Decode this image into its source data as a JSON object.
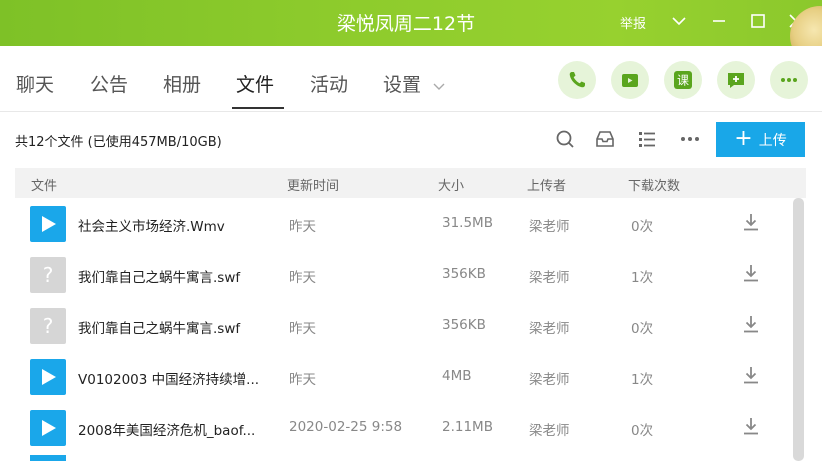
{
  "window": {
    "title": "梁悦凤周二12节",
    "report_label": "举报"
  },
  "tabs": [
    {
      "label": "聊天"
    },
    {
      "label": "公告"
    },
    {
      "label": "相册"
    },
    {
      "label": "文件",
      "active": true
    },
    {
      "label": "活动"
    },
    {
      "label": "设置"
    }
  ],
  "actions": [
    {
      "icon": "phone-icon"
    },
    {
      "icon": "video-call-icon"
    },
    {
      "icon": "lesson-icon",
      "text": "课"
    },
    {
      "icon": "add-message-icon"
    },
    {
      "icon": "more-icon"
    }
  ],
  "toolbar": {
    "summary": "共12个文件 (已使用457MB/10GB)",
    "upload_label": "上传"
  },
  "columns": {
    "file": "文件",
    "updated": "更新时间",
    "size": "大小",
    "uploader": "上传者",
    "downloads": "下载次数"
  },
  "files": [
    {
      "type": "video",
      "name": "社会主义市场经济.Wmv",
      "updated": "昨天",
      "size": "31.5MB",
      "uploader": "梁老师",
      "downloads": "0次"
    },
    {
      "type": "unknown",
      "name": "我们靠自己之蜗牛寓言.swf",
      "updated": "昨天",
      "size": "356KB",
      "uploader": "梁老师",
      "downloads": "1次"
    },
    {
      "type": "unknown",
      "name": "我们靠自己之蜗牛寓言.swf",
      "updated": "昨天",
      "size": "356KB",
      "uploader": "梁老师",
      "downloads": "0次"
    },
    {
      "type": "video",
      "name": "V0102003 中国经济持续增...",
      "updated": "昨天",
      "size": "4MB",
      "uploader": "梁老师",
      "downloads": "1次"
    },
    {
      "type": "video",
      "name": "2008年美国经济危机_baof...",
      "updated": "2020-02-25 9:58",
      "size": "2.11MB",
      "uploader": "梁老师",
      "downloads": "0次"
    }
  ],
  "colors": {
    "title_bar": "#8dcb2c",
    "accent_blue": "#19a7e8",
    "action_bg": "#e6f4d9",
    "action_fg": "#5aa51e"
  }
}
